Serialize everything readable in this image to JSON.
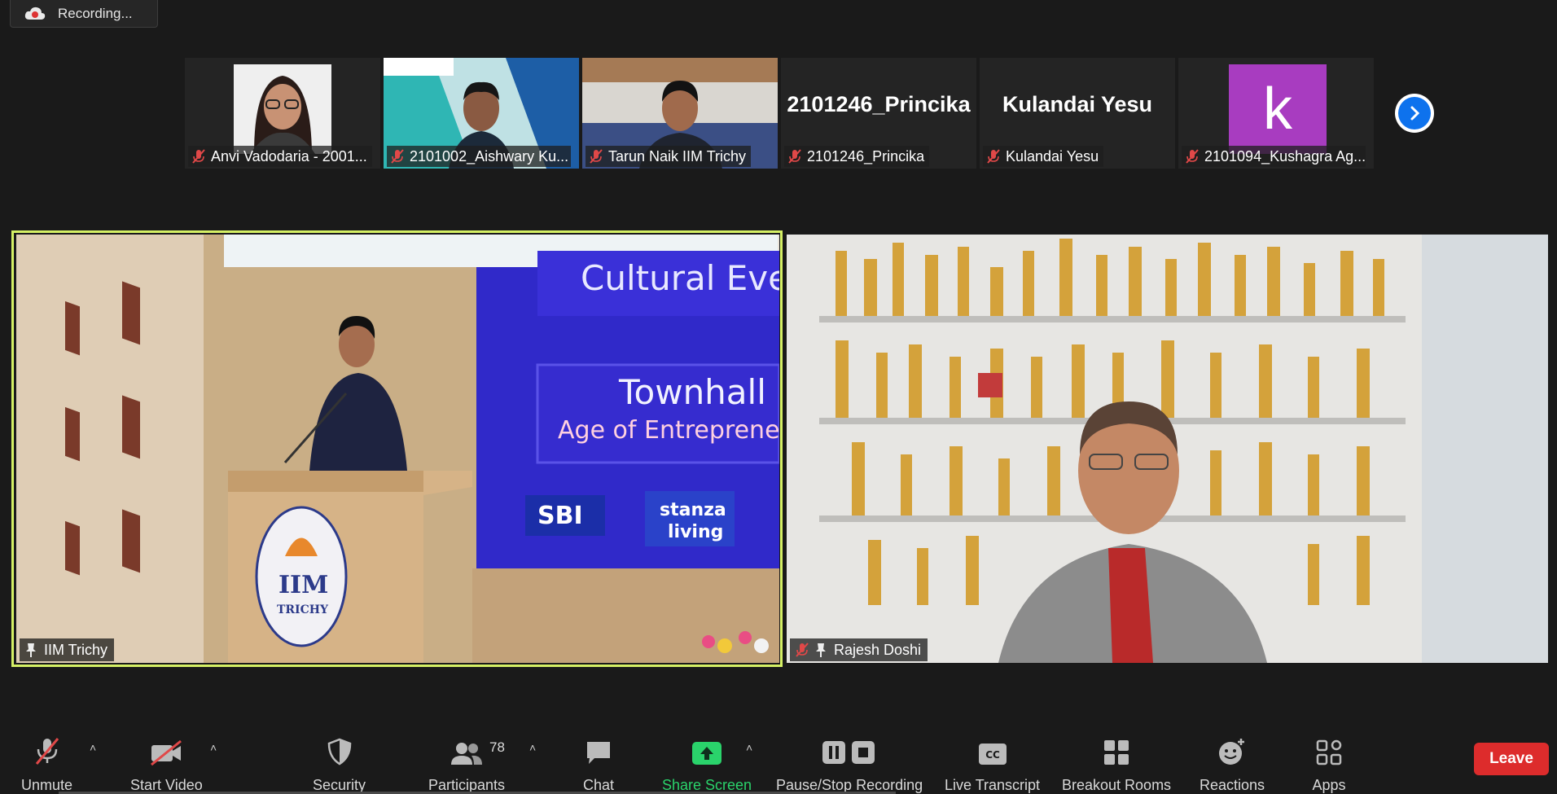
{
  "recording": {
    "label": "Recording..."
  },
  "thumbnails": [
    {
      "name": "Anvi Vadodaria - 2001...",
      "big_name": ""
    },
    {
      "name": "2101002_Aishwary Ku...",
      "big_name": ""
    },
    {
      "name": "Tarun Naik IIM Trichy",
      "big_name": ""
    },
    {
      "name": "2101246_Princika",
      "big_name": "2101246_Princika"
    },
    {
      "name": "Kulandai Yesu",
      "big_name": "Kulandai Yesu"
    },
    {
      "name": "2101094_Kushagra Ag...",
      "big_name": "",
      "avatar_letter": "k",
      "avatar_color": "#a83cc0"
    }
  ],
  "main_videos": [
    {
      "name": "IIM Trichy",
      "slide_text": [
        "Cultural Even",
        "Townhall",
        "Age of Entrepreneu"
      ],
      "logos": [
        "SBI",
        "stanza",
        "living"
      ],
      "podium_text": "IIM",
      "podium_sub": "TRICHY"
    },
    {
      "name": "Rajesh Doshi"
    }
  ],
  "toolbar": {
    "unmute": "Unmute",
    "start_video": "Start Video",
    "security": "Security",
    "participants": "Participants",
    "participants_count": "78",
    "chat": "Chat",
    "share_screen": "Share Screen",
    "pause_stop_recording": "Pause/Stop Recording",
    "live_transcript": "Live Transcript",
    "cc_badge": "CC",
    "breakout_rooms": "Breakout Rooms",
    "reactions": "Reactions",
    "apps": "Apps",
    "leave": "Leave"
  },
  "colors": {
    "active_speaker": "#d5f065",
    "leave": "#dd2c2c",
    "share": "#2ad36b",
    "accent": "#0e72ed"
  }
}
